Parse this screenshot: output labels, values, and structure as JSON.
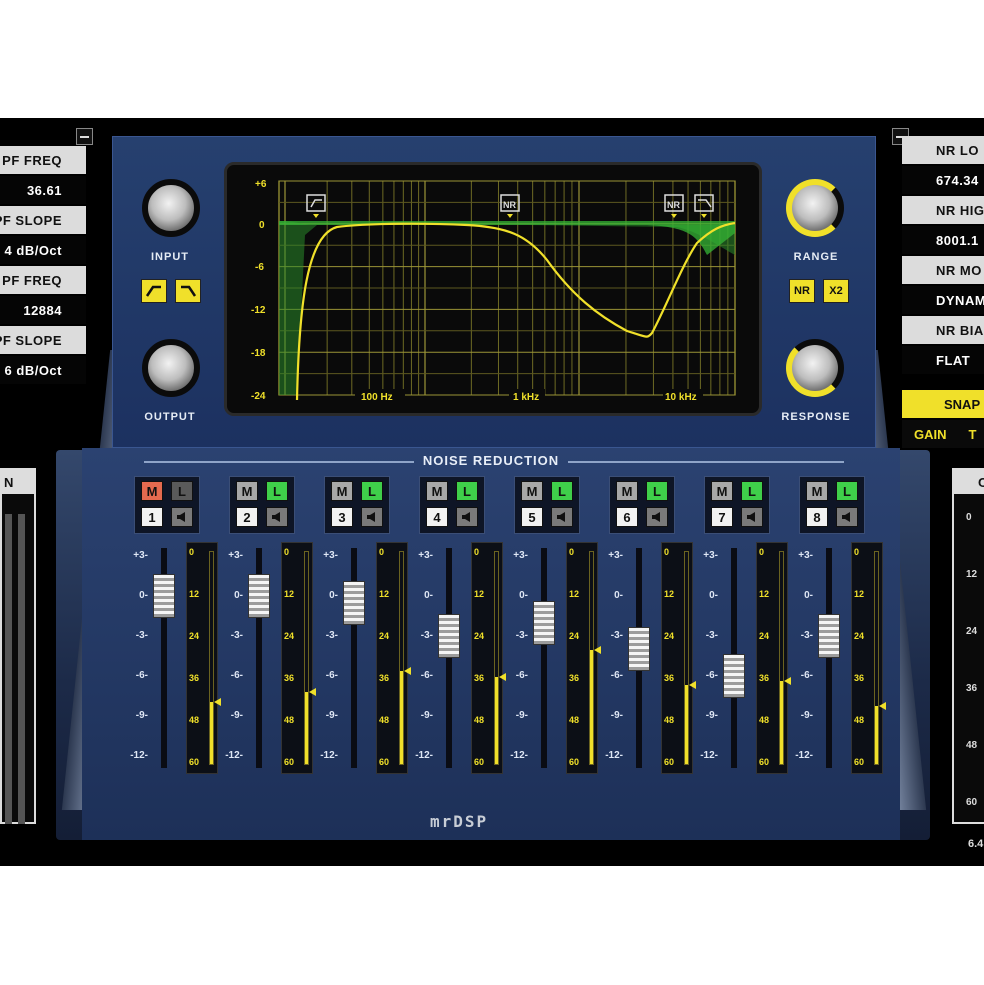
{
  "left_panel": {
    "params": [
      {
        "label": "PF FREQ",
        "value": "36.61"
      },
      {
        "label": "PF SLOPE",
        "value": "4 dB/Oct"
      },
      {
        "label": "PF FREQ",
        "value": "12884"
      },
      {
        "label": "PF SLOPE",
        "value": "6 dB/Oct"
      }
    ],
    "meter_header": "N"
  },
  "right_panel": {
    "params": [
      {
        "label": "NR LO",
        "value": "674.34"
      },
      {
        "label": "NR HIG",
        "value": "8001.1"
      },
      {
        "label": "NR MO",
        "value": "DYNAM"
      },
      {
        "label": "NR BIA",
        "value": "FLAT"
      }
    ],
    "snap_label": "SNAP",
    "gain_label": "GAIN",
    "gain_extra": "T",
    "meter_header": "O",
    "meter_scale": [
      "0",
      "12",
      "24",
      "36",
      "48",
      "60"
    ],
    "bottom_value": "6.4"
  },
  "controls": {
    "input_label": "INPUT",
    "output_label": "OUTPUT",
    "range_label": "RANGE",
    "response_label": "RESPONSE",
    "nr_button": "NR",
    "x2_button": "X2"
  },
  "eq_display": {
    "y_ticks": [
      "+6",
      "0",
      "-6",
      "-12",
      "-18",
      "-24"
    ],
    "x_labels": [
      "100 Hz",
      "1 kHz",
      "10 kHz"
    ],
    "markers": [
      "NR",
      "NR"
    ]
  },
  "section_title": "NOISE REDUCTION",
  "fader_scale": [
    "+3-",
    "0-",
    "-3-",
    "-6-",
    "-9-",
    "-12-"
  ],
  "meter_scale": [
    "0",
    "12",
    "24",
    "36",
    "48",
    "60"
  ],
  "channels": [
    {
      "num": "1",
      "m": "M",
      "l": "L",
      "mute_active": true,
      "listen_active": false,
      "fader_db": 0,
      "meter_level": 0.3
    },
    {
      "num": "2",
      "m": "M",
      "l": "L",
      "mute_active": false,
      "listen_active": true,
      "fader_db": 0,
      "meter_level": 0.35
    },
    {
      "num": "3",
      "m": "M",
      "l": "L",
      "mute_active": false,
      "listen_active": true,
      "fader_db": -0.5,
      "meter_level": 0.45
    },
    {
      "num": "4",
      "m": "M",
      "l": "L",
      "mute_active": false,
      "listen_active": true,
      "fader_db": -3,
      "meter_level": 0.42
    },
    {
      "num": "5",
      "m": "M",
      "l": "L",
      "mute_active": false,
      "listen_active": true,
      "fader_db": -2,
      "meter_level": 0.55
    },
    {
      "num": "6",
      "m": "M",
      "l": "L",
      "mute_active": false,
      "listen_active": true,
      "fader_db": -4,
      "meter_level": 0.38
    },
    {
      "num": "7",
      "m": "M",
      "l": "L",
      "mute_active": false,
      "listen_active": true,
      "fader_db": -6,
      "meter_level": 0.4
    },
    {
      "num": "8",
      "m": "M",
      "l": "L",
      "mute_active": false,
      "listen_active": true,
      "fader_db": -3,
      "meter_level": 0.28
    }
  ],
  "logo_text": "mrDSP",
  "colors": {
    "accent_yellow": "#f0e02a",
    "panel_blue": "#1f3566",
    "listen_green": "#3fcf4a",
    "mute_red": "#e56a4f"
  }
}
